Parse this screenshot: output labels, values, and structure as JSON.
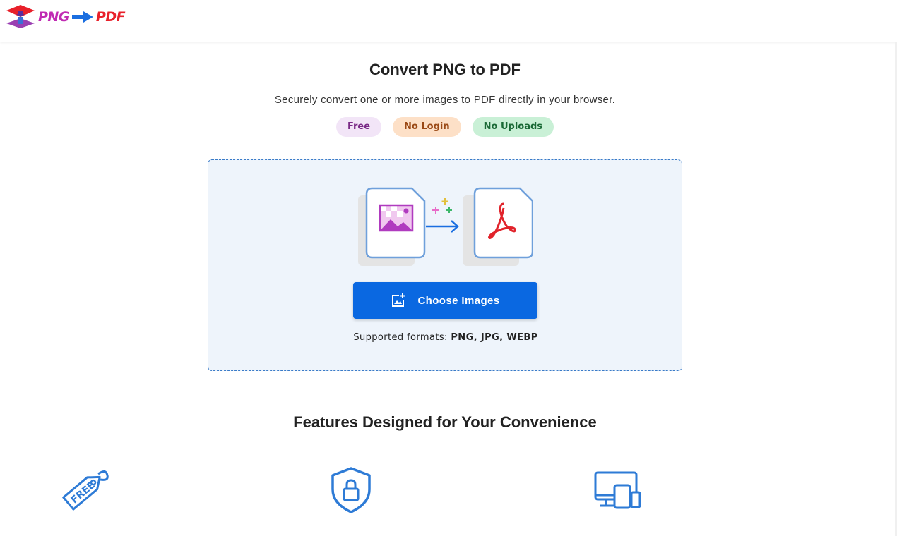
{
  "header": {
    "logo_png": "PNG",
    "logo_pdf": "PDF",
    "logo_icon": "layers-upload-icon",
    "arrow_icon": "arrow-right-icon"
  },
  "hero": {
    "title": "Convert PNG to PDF",
    "subtitle": "Securely convert one or more images to PDF directly in your browser.",
    "badges": [
      "Free",
      "No Login",
      "No Uploads"
    ]
  },
  "dropzone": {
    "illustration_icons": [
      "image-file-icon",
      "sparkle-icon",
      "arrow-right-icon",
      "pdf-file-icon"
    ],
    "button_label": "Choose Images",
    "button_icon": "add-photo-icon",
    "formats_prefix": "Supported formats:",
    "formats_list": "PNG, JPG, WEBP"
  },
  "features": {
    "title": "Features Designed for Your Convenience",
    "icons": [
      "free-tag-icon",
      "shield-lock-icon",
      "devices-icon"
    ]
  },
  "colors": {
    "accent": "#0a68e1",
    "icon_blue": "#2e7bd6",
    "dropzone_bg": "#eef4fb",
    "logo_magenta": "#c02bb3",
    "logo_red": "#e8202a"
  }
}
